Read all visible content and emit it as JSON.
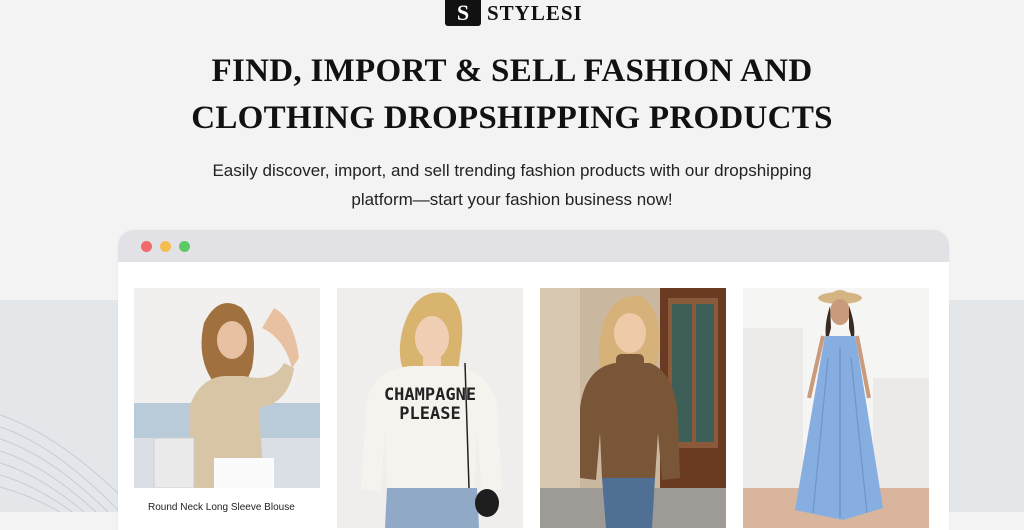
{
  "brand": {
    "mark": "S",
    "name": "STYLESI"
  },
  "hero": {
    "headline_line1": "FIND, IMPORT & SELL FASHION AND",
    "headline_line2": "CLOTHING DROPSHIPPING PRODUCTS",
    "subtitle_line1": "Easily discover, import, and sell trending fashion products with our dropshipping",
    "subtitle_line2": "platform—start your fashion business now!"
  },
  "browser": {
    "dots": [
      "#f26b6b",
      "#f4bd4f",
      "#5cc965"
    ]
  },
  "products": [
    {
      "caption": "Round Neck Long Sleeve Blouse",
      "image": "woman-beige-blouse",
      "shirt_text": ""
    },
    {
      "caption": "",
      "image": "woman-champagne-sweater",
      "shirt_text": "CHAMPAGNE PLEASE"
    },
    {
      "caption": "",
      "image": "woman-brown-turtleneck",
      "shirt_text": ""
    },
    {
      "caption": "",
      "image": "woman-blue-maxi-dress",
      "shirt_text": ""
    }
  ]
}
